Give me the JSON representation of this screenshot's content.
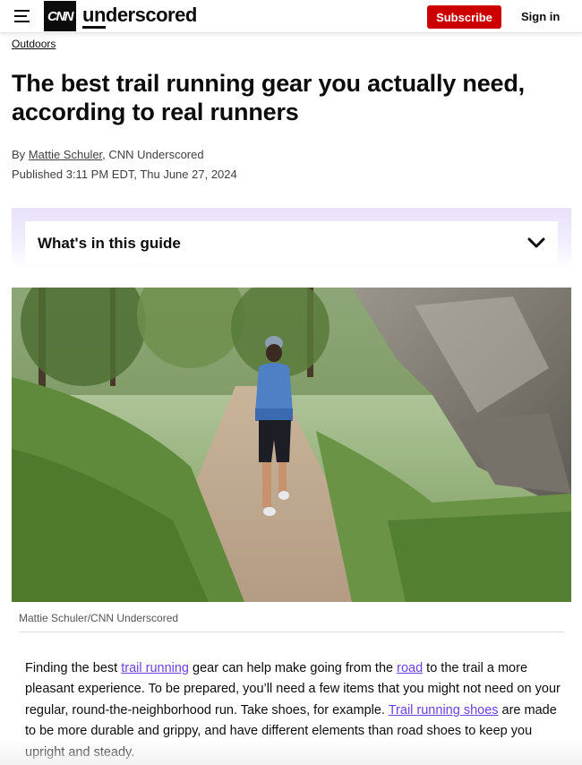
{
  "header": {
    "logo_text": "CNN",
    "brand": "underscored",
    "subscribe_label": "Subscribe",
    "signin_label": "Sign in",
    "accent_color": "#cc0000"
  },
  "article": {
    "section": "Outdoors",
    "title": "The best trail running gear you actually need, according to real runners",
    "byline_prefix": "By ",
    "author": "Mattie Schuler",
    "byline_suffix": ", CNN Underscored",
    "published": "Published 3:11 PM EDT, Thu June 27, 2024"
  },
  "guide": {
    "label": "What's in this guide",
    "icon": "chevron-down-icon"
  },
  "hero": {
    "caption": "Mattie Schuler/CNN Underscored"
  },
  "body": {
    "p1_a": "Finding the best ",
    "link1": "trail running",
    "p1_b": " gear can help make going from the ",
    "link2": "road",
    "p1_c": " to the trail a more pleasant experience. To be prepared, you’ll need a few items that you might not need on your regular, round-the-neighborhood run. Take shoes, for example. ",
    "link3": "Trail running shoes",
    "p1_d": " are made to be more durable and grippy, and have different elements than road shoes to keep you upright and steady.",
    "link_color": "#6e3ee6"
  }
}
